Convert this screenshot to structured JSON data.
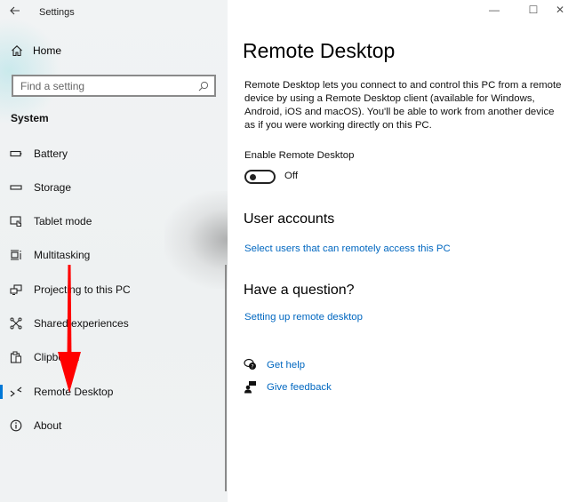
{
  "window": {
    "app_title": "Settings",
    "controls": {
      "minimize": "—",
      "maximize": "☐",
      "close": "✕"
    }
  },
  "sidebar": {
    "home_label": "Home",
    "search": {
      "placeholder": "Find a setting",
      "value": ""
    },
    "section_label": "System",
    "items": [
      {
        "label": "Battery",
        "icon": "battery-icon",
        "selected": false
      },
      {
        "label": "Storage",
        "icon": "storage-icon",
        "selected": false
      },
      {
        "label": "Tablet mode",
        "icon": "tablet-mode-icon",
        "selected": false
      },
      {
        "label": "Multitasking",
        "icon": "multitasking-icon",
        "selected": false
      },
      {
        "label": "Projecting to this PC",
        "icon": "projecting-icon",
        "selected": false
      },
      {
        "label": "Shared experiences",
        "icon": "shared-experiences-icon",
        "selected": false
      },
      {
        "label": "Clipboard",
        "icon": "clipboard-icon",
        "selected": false
      },
      {
        "label": "Remote Desktop",
        "icon": "remote-desktop-icon",
        "selected": true
      },
      {
        "label": "About",
        "icon": "info-icon",
        "selected": false
      }
    ]
  },
  "main": {
    "title": "Remote Desktop",
    "description": "Remote Desktop lets you connect to and control this PC from a remote device by using a Remote Desktop client (available for Windows, Android, iOS and macOS). You'll be able to work from another device as if you were working directly on this PC.",
    "enable_label": "Enable Remote Desktop",
    "toggle_state": "Off",
    "user_accounts_heading": "User accounts",
    "user_accounts_link": "Select users that can remotely access this PC",
    "question_heading": "Have a question?",
    "question_link": "Setting up remote desktop",
    "get_help": "Get help",
    "give_feedback": "Give feedback"
  },
  "colors": {
    "accent": "#0078d7",
    "link": "#0067c0",
    "annotation_arrow": "#ff0000"
  }
}
